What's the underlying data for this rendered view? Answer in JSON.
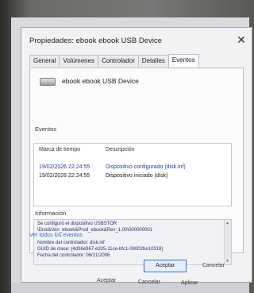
{
  "window": {
    "title": "Propiedades: ebook ebook USB Device",
    "close_glyph": "✕"
  },
  "tabs": [
    {
      "label": "General",
      "active": false
    },
    {
      "label": "Volúmenes",
      "active": false
    },
    {
      "label": "Controlador",
      "active": false
    },
    {
      "label": "Detalles",
      "active": false
    },
    {
      "label": "Eventos",
      "active": true
    }
  ],
  "device": {
    "name": "ebook ebook USB Device",
    "icon": "usb-drive-icon"
  },
  "events": {
    "section_label": "Eventos",
    "columns": [
      "Marca de tiempo",
      "Descripción"
    ],
    "rows": [
      {
        "timestamp": "19/02/2026 22:24:55",
        "description": "Dispositivo configurado (disk.inf)",
        "selected": true
      },
      {
        "timestamp": "19/02/2026 22:24:55",
        "description": "Dispositivo iniciado (disk)",
        "selected": false
      }
    ]
  },
  "info": {
    "section_label": "Información",
    "lines": [
      "Se configuró el dispositivo USBSTOR",
      "\\Disk&Ven_ebook&Prod_ebook&Rev_1.00\\000000001",
      "",
      "Nombre del controlador: disk.inf",
      "GUID de clase: {4d36e967-e325-11ce-bfc1-08002be10318}",
      "Fecha del controlador: 06/21/2006"
    ]
  },
  "link_text": "Ver todos los eventos",
  "buttons": {
    "accept": "Aceptar",
    "cancel": "Cancelar"
  },
  "background_buttons": {
    "accept": "Aceptar",
    "cancel": "Cancelar",
    "apply": "Aplicar"
  }
}
